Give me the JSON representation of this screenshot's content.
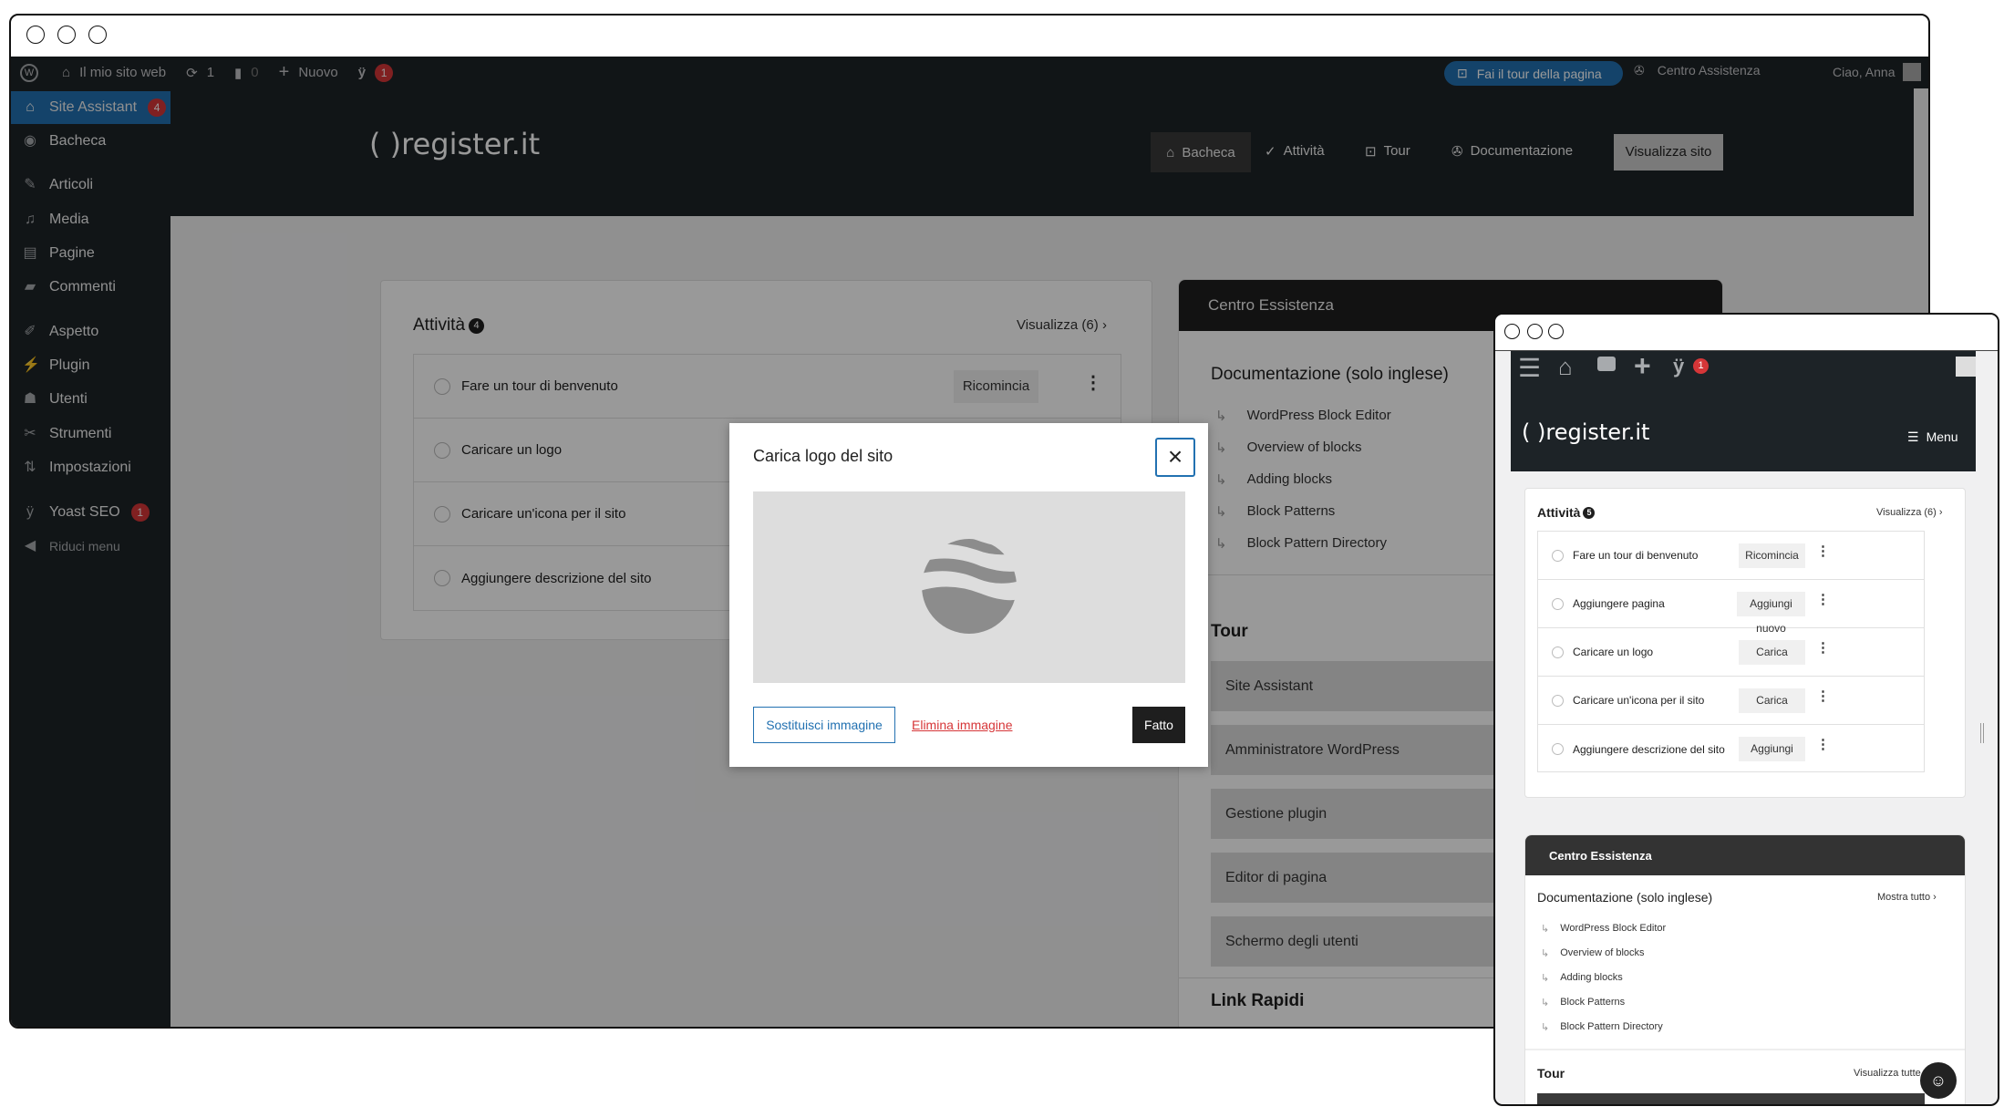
{
  "main": {
    "adminbar": {
      "site_name": "Il mio sito web",
      "updates": "1",
      "comments": "0",
      "new_label": "Nuovo",
      "yoast_count": "1",
      "tour_button": "Fai il tour della pagina",
      "help_center": "Centro Assistenza",
      "greeting": "Ciao, Anna"
    },
    "sidebar": {
      "items": [
        {
          "label": "Site Assistant",
          "badge": "4",
          "icon": "home-icon"
        },
        {
          "label": "Bacheca",
          "icon": "dashboard-icon"
        },
        {
          "label": "Articoli",
          "icon": "pin-icon"
        },
        {
          "label": "Media",
          "icon": "media-icon"
        },
        {
          "label": "Pagine",
          "icon": "pages-icon"
        },
        {
          "label": "Commenti",
          "icon": "comment-icon"
        },
        {
          "label": "Aspetto",
          "icon": "brush-icon"
        },
        {
          "label": "Plugin",
          "icon": "plugin-icon"
        },
        {
          "label": "Utenti",
          "icon": "user-icon"
        },
        {
          "label": "Strumenti",
          "icon": "wrench-icon"
        },
        {
          "label": "Impostazioni",
          "icon": "settings-icon"
        },
        {
          "label": "Yoast SEO",
          "badge": "1",
          "icon": "yoast-icon"
        },
        {
          "label": "Riduci menu",
          "icon": "collapse-icon"
        }
      ]
    },
    "header": {
      "logo": "( )register.it",
      "nav": [
        "Bacheca",
        "Attività",
        "Tour",
        "Documentazione"
      ],
      "view_site": "Visualizza sito"
    },
    "tasks": {
      "title": "Attività",
      "count": "4",
      "view_all": "Visualizza (6)",
      "items": [
        {
          "label": "Fare un tour di benvenuto",
          "action": "Ricomincia"
        },
        {
          "label": "Caricare un logo"
        },
        {
          "label": "Caricare un'icona per il sito"
        },
        {
          "label": "Aggiungere descrizione del sito"
        }
      ]
    },
    "help": {
      "title": "Centro Essistenza",
      "docs_title": "Documentazione (solo inglese)",
      "docs": [
        "WordPress Block Editor",
        "Overview of blocks",
        "Adding blocks",
        "Block Patterns",
        "Block Pattern Directory"
      ],
      "tour_title": "Tour",
      "tours": [
        "Site Assistant",
        "Amministratore WordPress",
        "Gestione plugin",
        "Editor di pagina",
        "Schermo degli utenti"
      ],
      "quick_links": "Link Rapidi"
    }
  },
  "modal": {
    "title": "Carica logo del sito",
    "replace": "Sostituisci immagine",
    "delete": "Elimina immagine",
    "done": "Fatto"
  },
  "mobile": {
    "yoast_count": "1",
    "logo": "( )register.it",
    "menu": "Menu",
    "tasks": {
      "title": "Attività",
      "count": "5",
      "view_all": "Visualizza (6)",
      "items": [
        {
          "label": "Fare un tour di benvenuto",
          "action": "Ricomincia"
        },
        {
          "label": "Aggiungere pagina",
          "action": "Aggiungi nuovo"
        },
        {
          "label": "Caricare un logo",
          "action": "Carica"
        },
        {
          "label": "Caricare un'icona per il sito",
          "action": "Carica"
        },
        {
          "label": "Aggiungere descrizione del sito",
          "action": "Aggiungi"
        }
      ]
    },
    "help": {
      "title": "Centro Essistenza",
      "docs_title": "Documentazione (solo inglese)",
      "show_all": "Mostra tutto",
      "docs": [
        "WordPress Block Editor",
        "Overview of blocks",
        "Adding blocks",
        "Block Patterns",
        "Block Pattern Directory"
      ],
      "tour_title": "Tour",
      "view_all": "Visualizza tutte"
    }
  },
  "colors": {
    "accent": "#2271b1",
    "danger": "#d63638",
    "dark": "#1d2327"
  }
}
